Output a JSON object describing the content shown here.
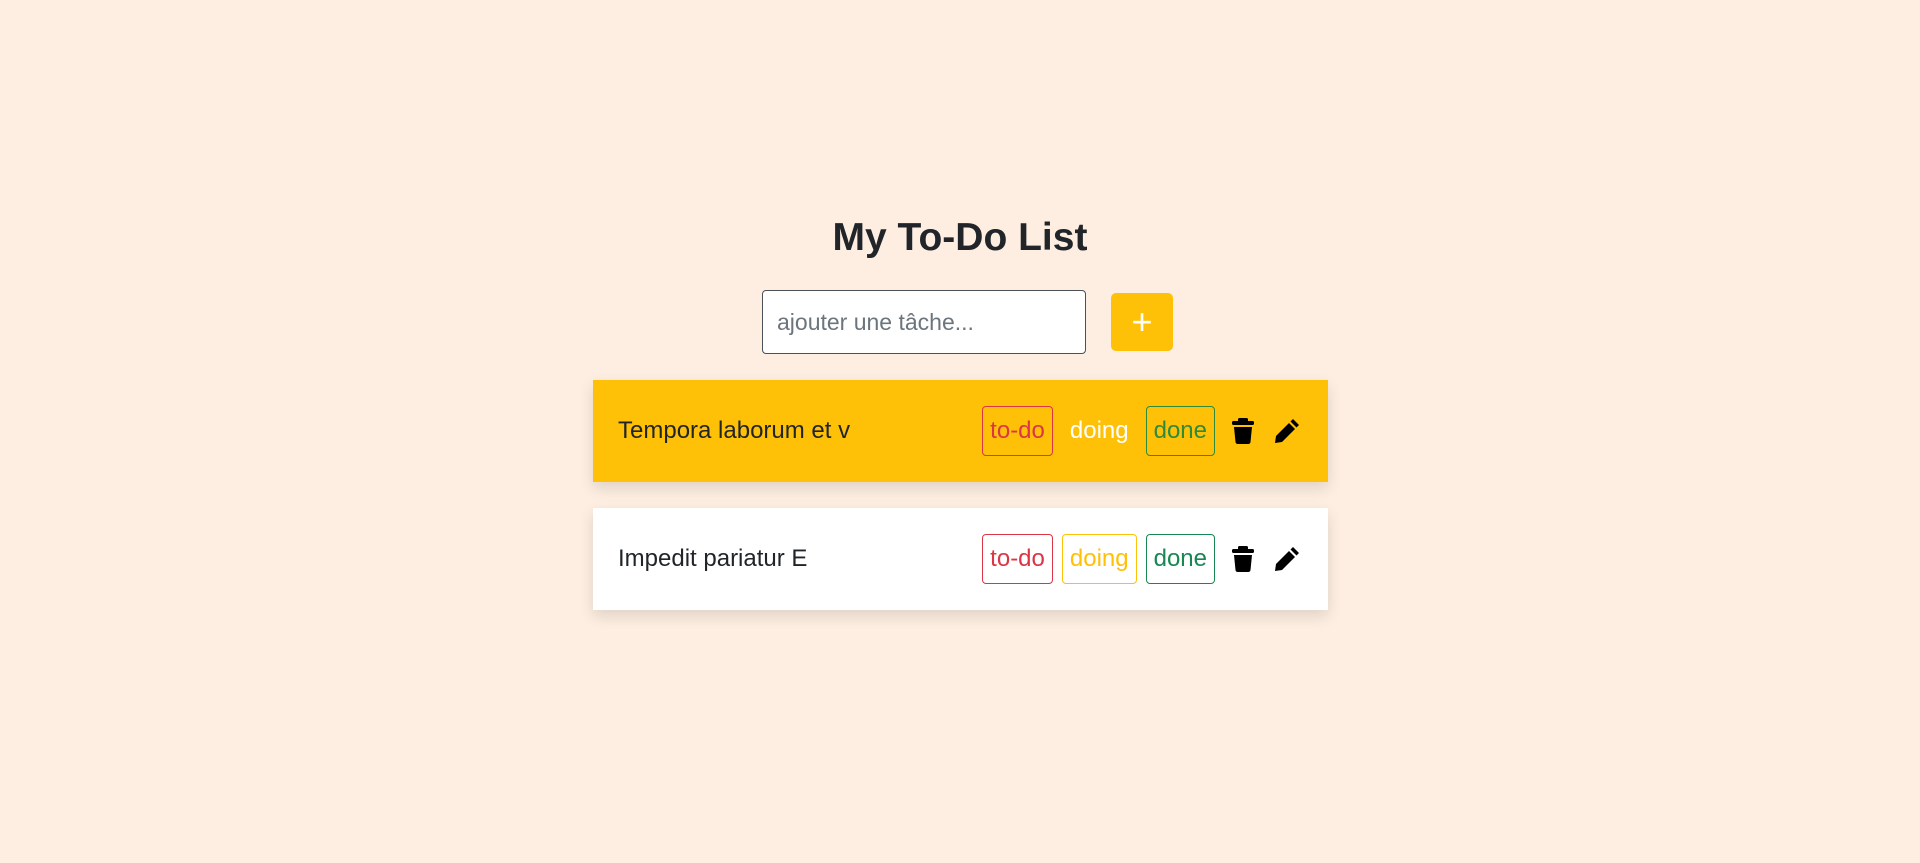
{
  "page": {
    "title": "My To-Do List"
  },
  "add_form": {
    "placeholder": "ajouter une tâche...",
    "value": "",
    "add_label": "+"
  },
  "tasks": [
    {
      "text": "Tempora laborum et v",
      "status": "doing",
      "todo_label": "to-do",
      "doing_label": "doing",
      "done_label": "done",
      "delete_icon": "trash-icon",
      "edit_icon": "pencil-icon"
    },
    {
      "text": "Impedit pariatur E",
      "status": "none",
      "todo_label": "to-do",
      "doing_label": "doing",
      "done_label": "done",
      "delete_icon": "trash-icon",
      "edit_icon": "pencil-icon"
    }
  ],
  "colors": {
    "background": "#fdeee1",
    "accent": "#ffc107",
    "todo": "#dc3545",
    "done": "#198754"
  }
}
